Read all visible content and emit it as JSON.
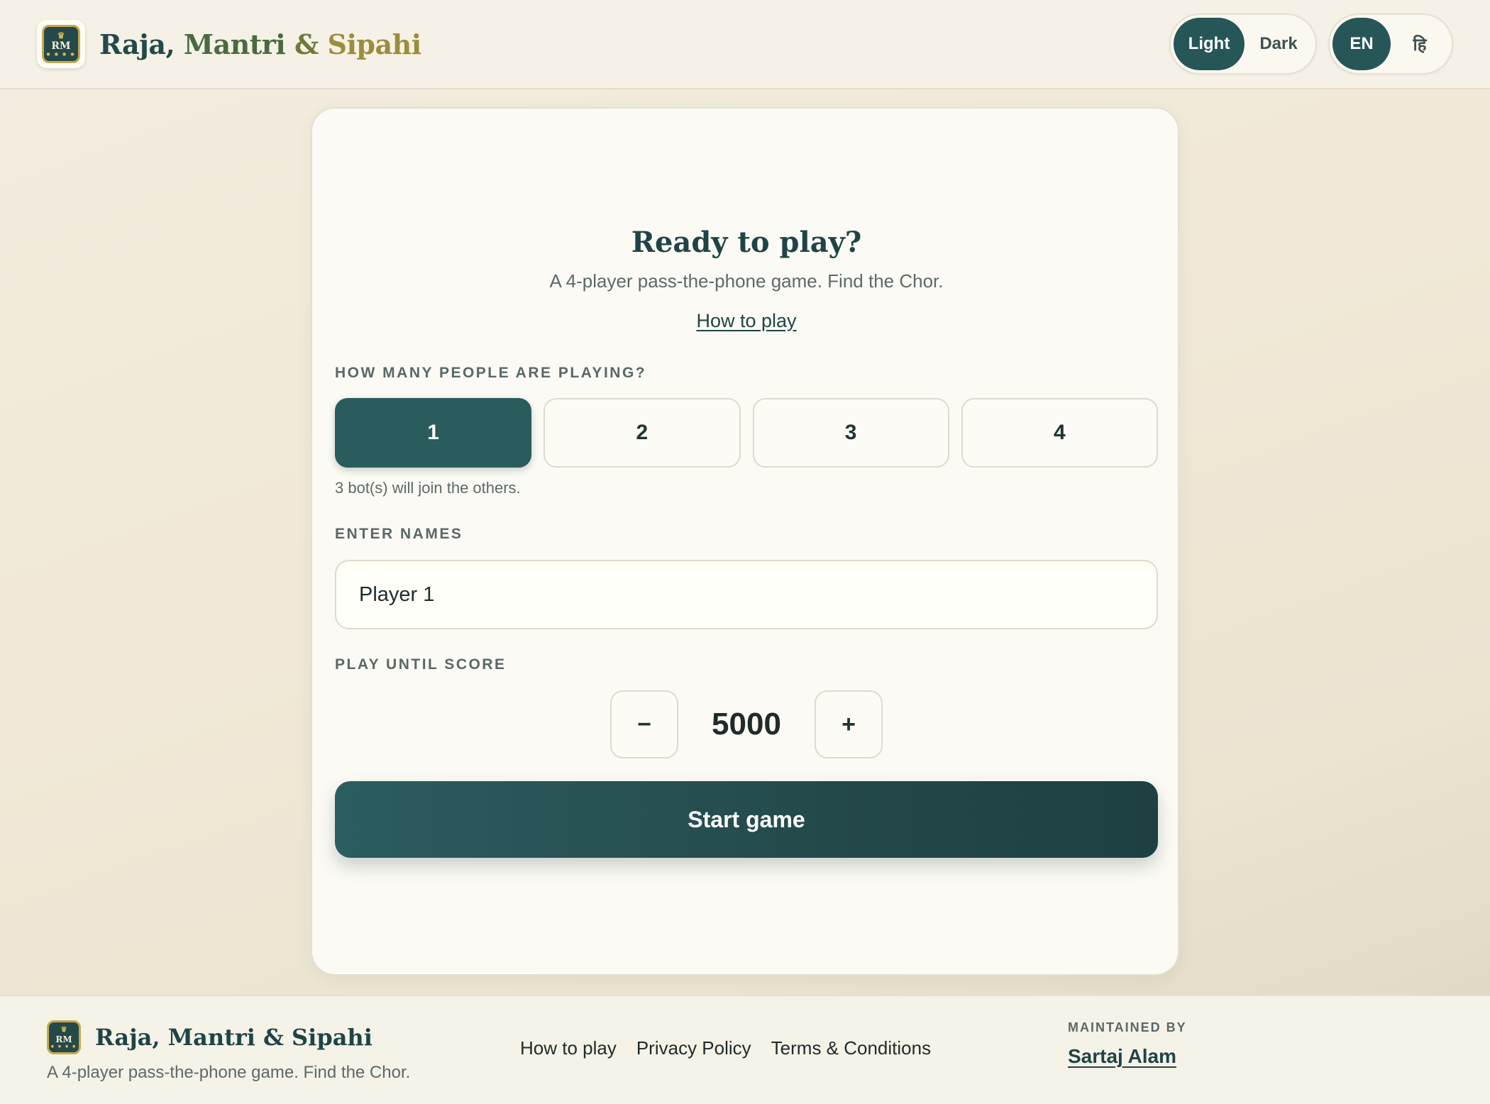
{
  "header": {
    "logo_text": "RM",
    "title_parts": [
      "Raja, ",
      "Mantri ",
      "& ",
      "Sipahi"
    ],
    "theme_toggle": {
      "light": "Light",
      "dark": "Dark",
      "selected": "Light"
    },
    "lang_toggle": {
      "en": "EN",
      "hi": "हि",
      "selected": "EN"
    }
  },
  "card": {
    "title": "Ready to play?",
    "subtitle": "A 4-player pass-the-phone game. Find the Chor.",
    "how_to_play": "How to play",
    "players_label": "HOW MANY PEOPLE ARE PLAYING?",
    "player_counts": [
      "1",
      "2",
      "3",
      "4"
    ],
    "selected_count": "1",
    "bots_note": "3 bot(s) will join the others.",
    "names_label": "ENTER NAMES",
    "name_value": "Player 1",
    "score_label": "PLAY UNTIL SCORE",
    "minus": "−",
    "score_value": "5000",
    "plus": "+",
    "start_button": "Start game"
  },
  "footer": {
    "logo_text": "RM",
    "title": "Raja, Mantri & Sipahi",
    "tagline": "A 4-player pass-the-phone game. Find the Chor.",
    "links": [
      "How to play",
      "Privacy Policy",
      "Terms & Conditions"
    ],
    "maintained_label": "MAINTAINED BY",
    "maintainer": "Sartaj Alam"
  },
  "colors": {
    "accent": "#265658",
    "background": "#efe8d6",
    "card": "#fcfaf4",
    "gold": "#c9a94a"
  }
}
